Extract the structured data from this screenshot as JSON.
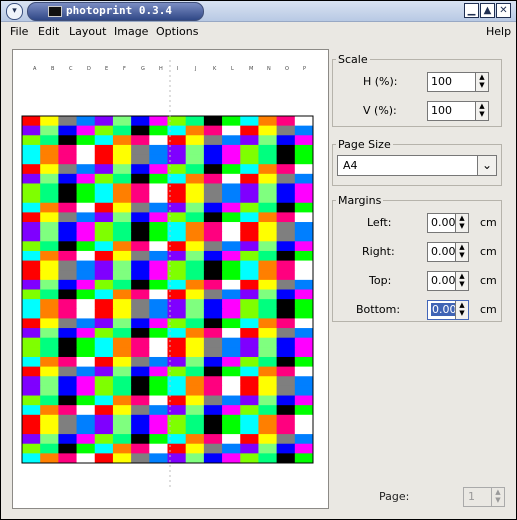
{
  "window": {
    "title": "photoprint 0.3.4"
  },
  "menus": [
    {
      "label": "File",
      "key": "F"
    },
    {
      "label": "Edit",
      "key": "E"
    },
    {
      "label": "Layout",
      "key": "L"
    },
    {
      "label": "Image",
      "key": "I"
    },
    {
      "label": "Options",
      "key": "O"
    },
    {
      "label": "Help",
      "key": "H"
    }
  ],
  "scale": {
    "title": "Scale",
    "h_label": "H (%):",
    "h_value": "100",
    "v_label": "V (%):",
    "v_value": "100"
  },
  "page_size": {
    "title": "Page Size",
    "value": "A4"
  },
  "margins": {
    "title": "Margins",
    "left_label": "Left:",
    "left_value": "0.00",
    "right_label": "Right:",
    "right_value": "0.00",
    "top_label": "Top:",
    "top_value": "0.00",
    "bottom_label": "Bottom:",
    "bottom_value": "0.00",
    "unit": "cm"
  },
  "page": {
    "label": "Page:",
    "value": "1"
  },
  "preview": {
    "ruler_marks": [
      "A",
      "B",
      "C",
      "D",
      "E",
      "F",
      "G",
      "H",
      "I",
      "J",
      "K",
      "L",
      "M",
      "N",
      "O",
      "P"
    ],
    "colors": [
      "#ff0000",
      "#00ff00",
      "#0000ff",
      "#ffff00",
      "#00ffff",
      "#ff00ff",
      "#7f7f7f",
      "#ff7f00",
      "#7fff00",
      "#007fff",
      "#ff007f",
      "#00ff7f",
      "#7f00ff",
      "#ffffff",
      "#000000",
      "#7fff7f"
    ]
  }
}
